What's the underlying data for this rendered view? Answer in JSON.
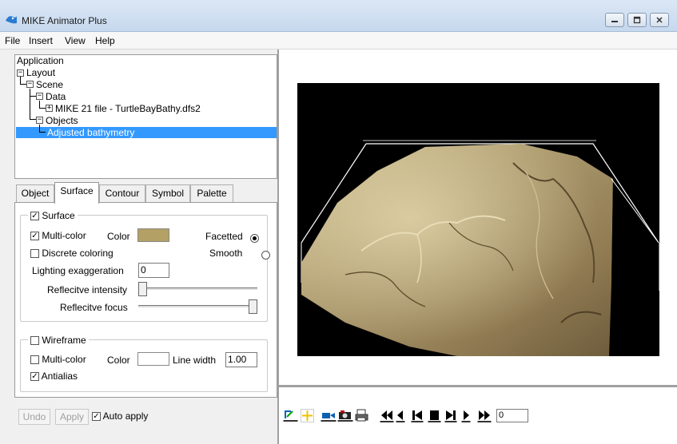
{
  "window": {
    "title": "MIKE Animator Plus"
  },
  "menu": [
    "File",
    "Insert",
    "View",
    "Help"
  ],
  "tree": {
    "application": "Application",
    "layout": "Layout",
    "scene": "Scene",
    "data": "Data",
    "file": "MIKE 21 file - TurtleBayBathy.dfs2",
    "objects": "Objects",
    "selected": "Adjusted bathymetry"
  },
  "tabs": [
    "Object",
    "Surface",
    "Contour",
    "Symbol",
    "Palette"
  ],
  "active_tab": "Surface",
  "surface": {
    "group_label": "Surface",
    "group_checked": true,
    "multicolor_label": "Multi-color",
    "multicolor_checked": true,
    "color_label": "Color",
    "color_value": "#b3a064",
    "facetted_label": "Facetted",
    "smooth_label": "Smooth",
    "shading": "Facetted",
    "discrete_label": "Discrete coloring",
    "discrete_checked": false,
    "lighting_label": "Lighting exaggeration",
    "lighting_value": "0",
    "intensity_label": "Reflecitve intensity",
    "intensity_level": 0.0,
    "focus_label": "Reflecitve focus",
    "focus_level": 1.0
  },
  "wireframe": {
    "group_label": "Wireframe",
    "group_checked": false,
    "multicolor_label": "Multi-color",
    "multicolor_checked": false,
    "color_label": "Color",
    "color_value": "#ffffff",
    "linewidth_label": "Line width",
    "linewidth_value": "1.00",
    "antialias_label": "Antialias",
    "antialias_checked": true
  },
  "bottom": {
    "undo_label": "Undo",
    "apply_label": "Apply",
    "autoapply_label": "Auto apply",
    "autoapply_checked": true
  },
  "toolbar": {
    "frame_value": "0",
    "icons": [
      "edit-view-icon",
      "add-light-icon",
      "record-video-icon",
      "snapshot-camera-icon",
      "print-icon",
      "fast-rewind-icon",
      "step-back-icon",
      "go-to-start-icon",
      "stop-icon",
      "go-to-end-icon",
      "play-icon",
      "fast-forward-icon"
    ]
  }
}
